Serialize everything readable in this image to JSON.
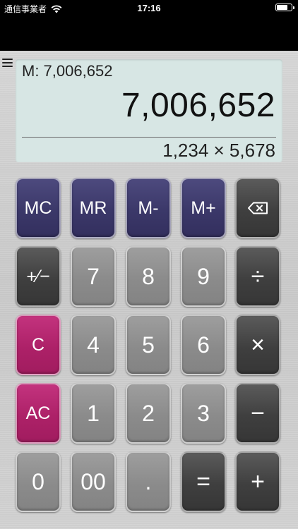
{
  "status_bar": {
    "carrier": "通信事業者",
    "time": "17:16",
    "battery_level": 0.85
  },
  "display": {
    "memory": "M: 7,006,652",
    "value": "7,006,652",
    "expression": "1,234 × 5,678"
  },
  "keys": {
    "mc": "MC",
    "mr": "MR",
    "m_minus": "M-",
    "m_plus": "M+",
    "sign": "+⁄−",
    "seven": "7",
    "eight": "8",
    "nine": "9",
    "divide": "÷",
    "clear": "C",
    "four": "4",
    "five": "5",
    "six": "6",
    "multiply": "×",
    "all_clear": "AC",
    "one": "1",
    "two": "2",
    "three": "3",
    "minus": "−",
    "zero": "0",
    "double_zero": "00",
    "decimal": ".",
    "equals": "=",
    "plus": "+"
  },
  "colors": {
    "memory_key": "#3b3869",
    "dark_key": "#3f3f3f",
    "number_key": "#8b8b8b",
    "clear_key": "#ad2168",
    "display_bg": "#d7e6e4"
  }
}
